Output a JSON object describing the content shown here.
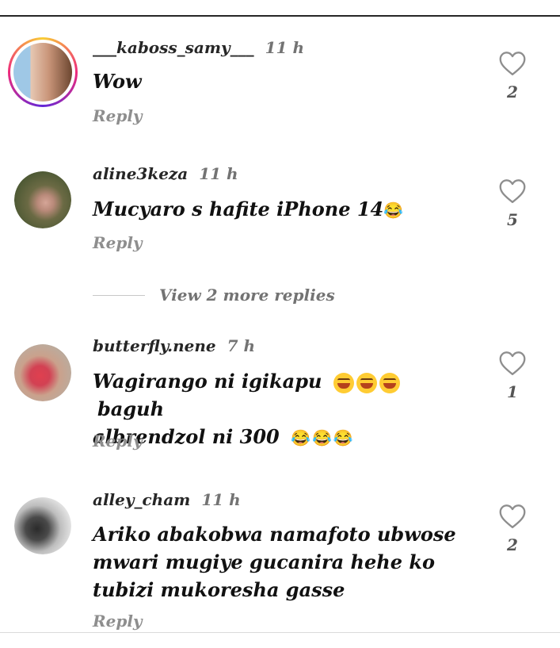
{
  "comments": [
    {
      "username": "___kaboss_samy___",
      "time": "11 h",
      "text": "Wow",
      "emoji": "",
      "reply": "Reply",
      "likes": "2",
      "avatar_colors": [
        "#e8d3c5",
        "#7a5038"
      ]
    },
    {
      "username": "aline3keza",
      "time": "11 h",
      "text": "Mucyaro s hafite iPhone 14",
      "emoji": "😂",
      "reply": "Reply",
      "likes": "5",
      "avatar_colors": [
        "#6d6a48",
        "#c89a8a"
      ]
    },
    {
      "username": "butterfly.nene",
      "time": "7 h",
      "text_line1": "Wagirango ni igikapu",
      "emoji_faces": "🤣🤣🤣",
      "text_line1_end": "baguh",
      "text_line2": "albrendzol ni 300",
      "emoji": "😂😂😂",
      "reply": "Reply",
      "likes": "1",
      "avatar_colors": [
        "#c9b7a8",
        "#d83a4a"
      ]
    },
    {
      "username": "alley_cham",
      "time": "11 h",
      "text": "Ariko abakobwa namafoto ubwose mwari mugiye gucanira hehe ko tubizi mukoresha gasse",
      "reply": "Reply",
      "likes": "2",
      "avatar_colors": [
        "#dcdcdc",
        "#333333"
      ]
    }
  ],
  "view_more_replies": "View 2 more replies",
  "icons": {
    "heart": "heart-outline-icon"
  }
}
